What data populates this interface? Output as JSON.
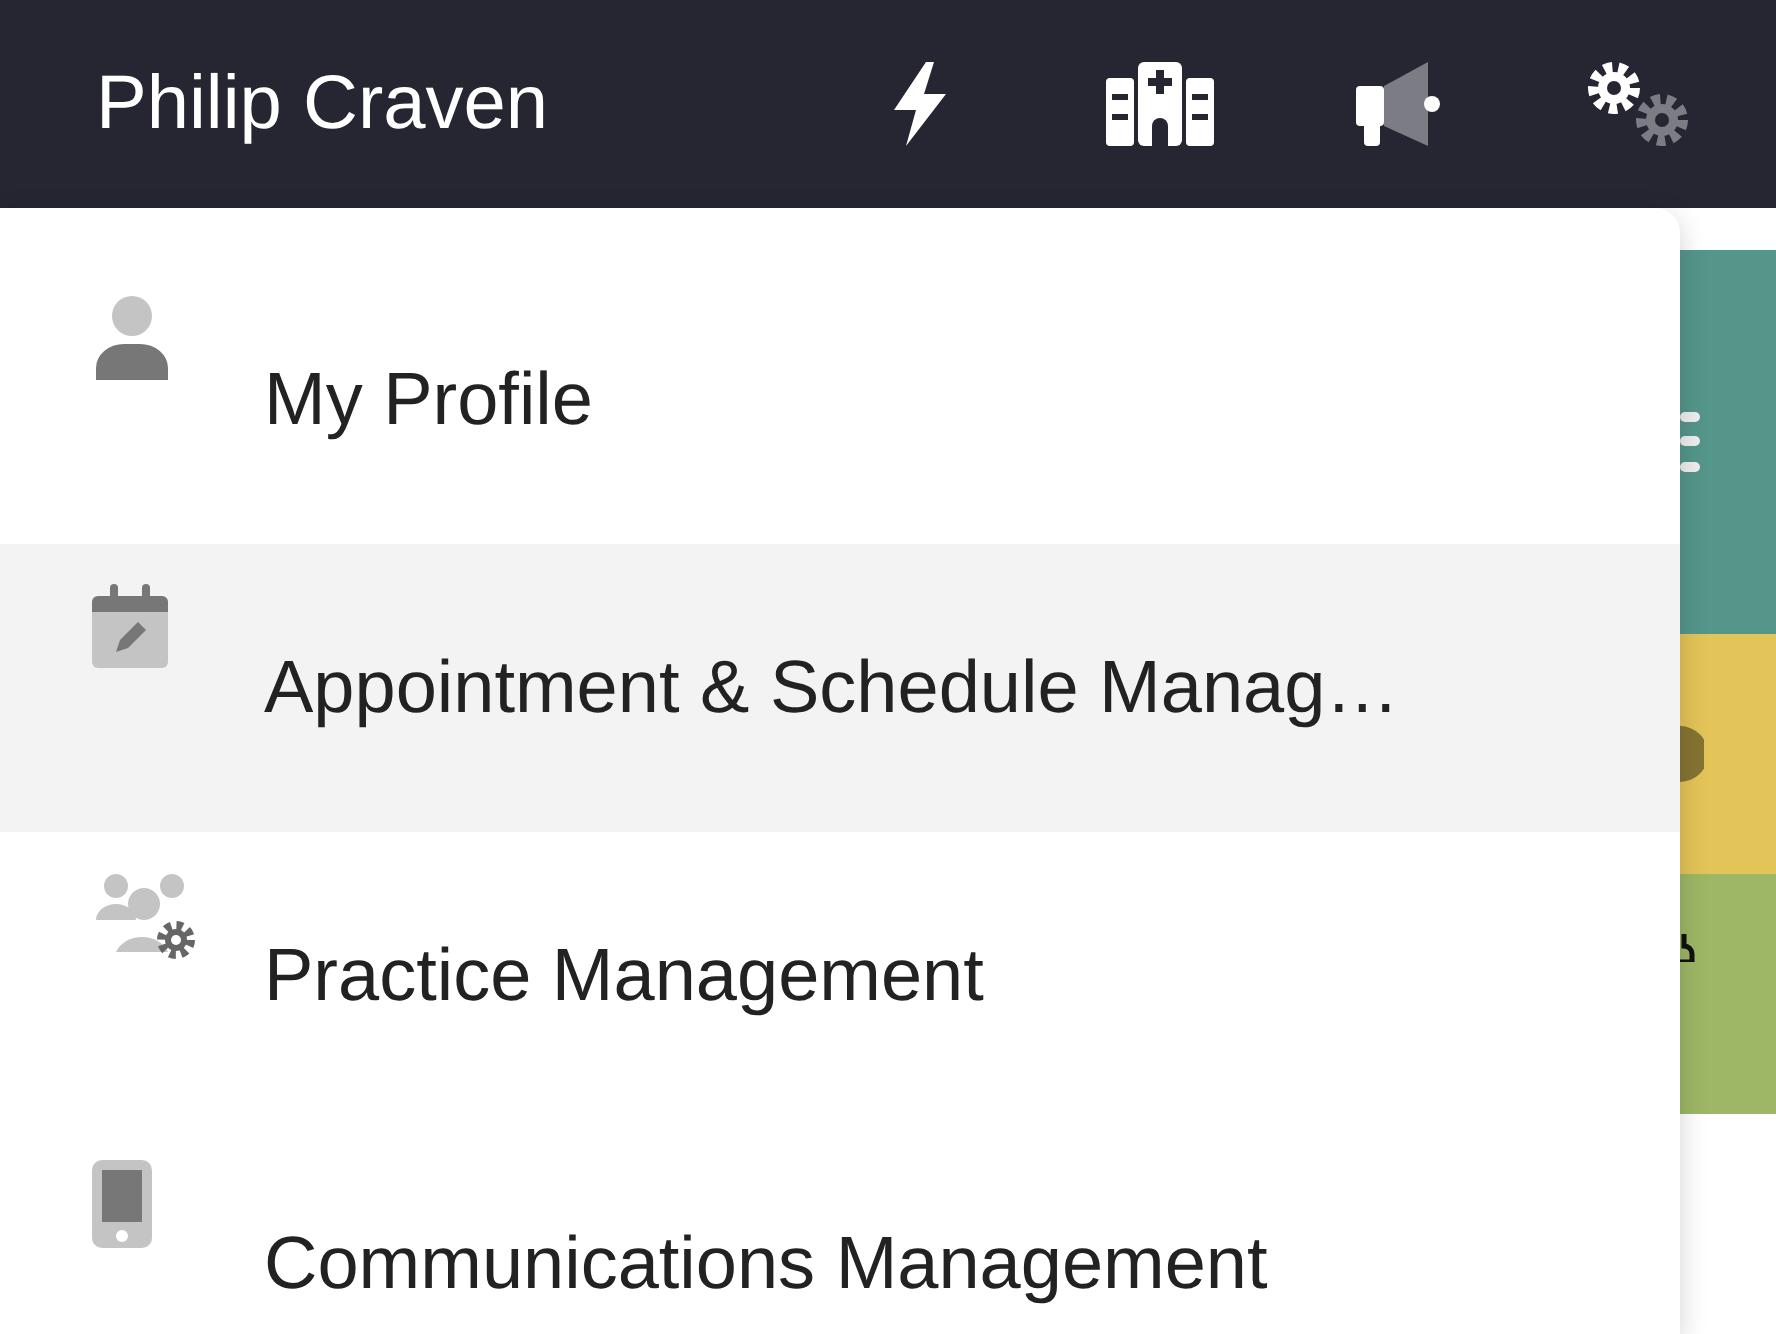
{
  "header": {
    "user_name": "Philip Craven"
  },
  "menu": {
    "items": [
      {
        "kind": "profile",
        "label": "My Profile",
        "selected": false
      },
      {
        "kind": "calendar",
        "label": "Appointment & Schedule Manag…",
        "selected": true
      },
      {
        "kind": "practice",
        "label": "Practice Management",
        "selected": false
      },
      {
        "kind": "phone",
        "label": "Communications Management",
        "selected": false
      }
    ]
  },
  "tiles": [
    {
      "kind": "menu",
      "color": "#55968a"
    },
    {
      "kind": "circle",
      "color": "#e3c458"
    },
    {
      "kind": "mark",
      "color": "#9db766"
    }
  ]
}
